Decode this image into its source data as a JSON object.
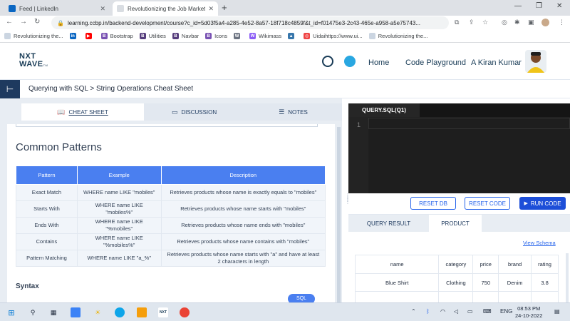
{
  "browser": {
    "tabs": [
      {
        "title": "Feed | LinkedIn",
        "active": false
      },
      {
        "title": "Revolutionizing the Job Market |",
        "active": true
      }
    ],
    "new_tab": "+",
    "url": "learning.ccbp.in/backend-development/course?c_id=5d03f5a4-a285-4e52-8a57-18f718c4859f&t_id=f01475e3-2c43-465e-a958-a5e75743...",
    "bookmarks": [
      "Revolutionizing the...",
      "",
      "",
      "Bootstrap",
      "Utilities",
      "Navbar",
      "Icons",
      "",
      "Wikimass",
      "",
      "Uidaihttps://www.ui...",
      "Revolutionizing the..."
    ]
  },
  "header": {
    "logo_line1": "NXT",
    "logo_line2": "WAVE",
    "logo_tm": "TM",
    "nav": [
      "Home",
      "Code Playground",
      "A Kiran Kumar"
    ]
  },
  "breadcrumb": {
    "toggle_icon": "⊢",
    "text": "Querying with SQL > String Operations Cheat Sheet"
  },
  "content_tabs": [
    {
      "label": "CHEAT SHEET",
      "icon": "book-icon",
      "active": true
    },
    {
      "label": "DISCUSSION",
      "icon": "chat-icon",
      "active": false
    },
    {
      "label": "NOTES",
      "icon": "notes-icon",
      "active": false
    }
  ],
  "cheat_sheet": {
    "heading": "Common Patterns",
    "columns": [
      "Pattern",
      "Example",
      "Description"
    ],
    "rows": [
      [
        "Exact Match",
        "WHERE name LIKE \"mobiles\"",
        "Retrieves products whose name is exactly equals to \"mobiles\""
      ],
      [
        "Starts With",
        "WHERE name LIKE \"mobiles%\"",
        "Retrieves products whose name starts with \"mobiles\""
      ],
      [
        "Ends With",
        "WHERE name LIKE \"%mobiles\"",
        "Retrieves products whose name ends with \"mobiles\""
      ],
      [
        "Contains",
        "WHERE name LIKE \"%mobiles%\"",
        "Retrieves products whose name contains with \"mobiles\""
      ],
      [
        "Pattern Matching",
        "WHERE name LIKE \"a_%\"",
        "Retrieves products whose name starts with \"a\" and have at least 2 characters in length"
      ]
    ],
    "syntax_heading": "Syntax",
    "sql_badge": "SQL"
  },
  "editor": {
    "tab_label": "QUERY.SQL(Q1)",
    "line_number": "1"
  },
  "buttons": {
    "reset_db": "RESET DB",
    "reset_code": "RESET CODE",
    "run_code": "RUN CODE"
  },
  "results": {
    "tabs": [
      "QUERY RESULT",
      "PRODUCT"
    ],
    "active_tab": "PRODUCT",
    "view_schema": "View Schema",
    "columns": [
      "name",
      "category",
      "price",
      "brand",
      "rating"
    ],
    "rows": [
      [
        "Blue Shirt",
        "Clothing",
        "750",
        "Denim",
        "3.8"
      ]
    ]
  },
  "taskbar": {
    "language": "ENG",
    "time": "08:53 PM",
    "date": "24-10-2022"
  },
  "colors": {
    "table_header": "#4a7ff0",
    "run_button": "#1d4ed8",
    "editor_bg": "#1e1e1e",
    "nav_dark": "#1e3a5f"
  }
}
